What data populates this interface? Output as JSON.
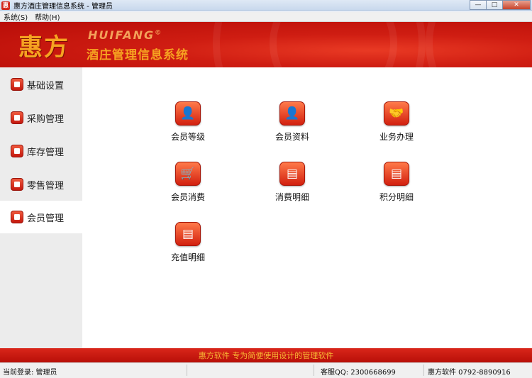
{
  "window": {
    "title": "惠方酒庄管理信息系统 - 管理员",
    "app_icon_text": "惠"
  },
  "window_controls": {
    "minimize": "—",
    "maximize": "□",
    "close": "✕"
  },
  "menu": [
    {
      "label": "系统(S)"
    },
    {
      "label": "帮助(H)"
    }
  ],
  "banner": {
    "logo_cn": "惠方",
    "logo_en": "HUIFANG",
    "logo_mark": "©",
    "subtitle": "酒庄管理信息系统"
  },
  "sidebar": {
    "items": [
      {
        "label": "基础设置",
        "icon": "settings-icon",
        "active": false
      },
      {
        "label": "采购管理",
        "icon": "purchase-icon",
        "active": false
      },
      {
        "label": "库存管理",
        "icon": "warehouse-icon",
        "active": false
      },
      {
        "label": "零售管理",
        "icon": "retail-icon",
        "active": false
      },
      {
        "label": "会员管理",
        "icon": "member-icon",
        "active": true
      }
    ]
  },
  "tiles": [
    {
      "label": "会员等级",
      "icon": "member-level-icon",
      "glyph": "👤"
    },
    {
      "label": "会员资料",
      "icon": "member-profile-icon",
      "glyph": "👤"
    },
    {
      "label": "业务办理",
      "icon": "handshake-icon",
      "glyph": "🤝"
    },
    {
      "label": "会员消费",
      "icon": "member-cart-icon",
      "glyph": "🛒"
    },
    {
      "label": "消费明细",
      "icon": "consumption-list-icon",
      "glyph": "▤"
    },
    {
      "label": "积分明细",
      "icon": "points-list-icon",
      "glyph": "▤"
    },
    {
      "label": "充值明细",
      "icon": "recharge-list-icon",
      "glyph": "▤"
    }
  ],
  "footer": {
    "slogan": "惠方软件  专为简便使用设计的管理软件"
  },
  "status": {
    "login": "当前登录: 管理员",
    "qq": "客服QQ: 2300668699",
    "company_phone": "惠方软件 0792-8890916"
  },
  "colors": {
    "brand_red": "#cf1d12",
    "brand_gold": "#f6a321",
    "sidebar_bg": "#ececec"
  }
}
